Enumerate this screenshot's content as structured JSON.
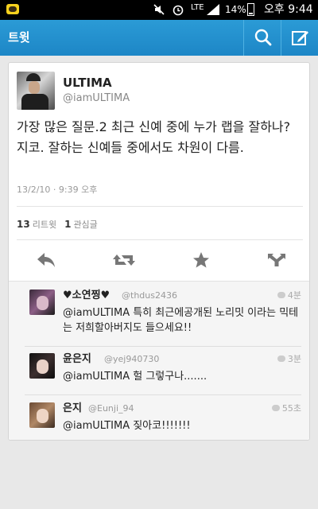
{
  "status_bar": {
    "battery_percent": "14%",
    "battery_level": 0.14,
    "network": "LTE",
    "clock": "오후 9:44",
    "icons": [
      "kakaotalk-icon",
      "mute-icon",
      "alarm-icon",
      "lte-signal-icon",
      "battery-icon"
    ]
  },
  "action_bar": {
    "title": "트윗",
    "color": "#2294d0",
    "buttons": [
      "search-icon",
      "compose-icon"
    ]
  },
  "tweet": {
    "author_name": "ULTIMA",
    "author_handle": "@iamULTIMA",
    "text": "가장 많은 질문.2 최근 신예 중에 누가 랩을 잘하나? 지코. 잘하는 신예들 중에서도 차원이 다름.",
    "timestamp": "13/2/10 · 9:39 오후",
    "retweet_count": "13",
    "retweet_label": "리트윗",
    "favorite_count": "1",
    "favorite_label": "관심글",
    "actions": [
      "reply-icon",
      "retweet-icon",
      "favorite-icon",
      "more-icon"
    ]
  },
  "replies": [
    {
      "name": "♥소연찡♥",
      "handle": "@thdus2436",
      "time": "4분",
      "text": "@iamULTIMA 특히 최근에공개된 노리밋 이라는 믹테는 저희할아버지도 들으세요!!"
    },
    {
      "name": "윤은지",
      "handle": "@yej940730",
      "time": "3분",
      "text": "@iamULTIMA 헐 그렇구나......."
    },
    {
      "name": "은지",
      "handle": "@Eunji_94",
      "time": "55초",
      "text": "@iamULTIMA 짖아코!!!!!!!"
    }
  ]
}
